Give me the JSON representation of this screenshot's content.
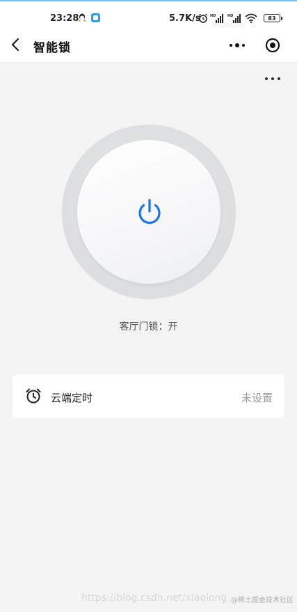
{
  "status_bar": {
    "time": "23:28",
    "network_speed": "5.7K/s",
    "battery": "83",
    "icons": [
      "qq-icon",
      "app-icon",
      "alarm-status-icon",
      "hd-signal-icon",
      "hd-signal-icon",
      "wifi-icon",
      "battery-icon"
    ]
  },
  "nav": {
    "title": "智能锁"
  },
  "device": {
    "status_text": "客厅门锁：开",
    "power_color": "#1a73e8"
  },
  "timer": {
    "label": "云端定时",
    "value": "未设置"
  },
  "watermark": {
    "text": "https://blog.csdn.net/xiaolong",
    "badge": "@稀土掘金技术社区"
  }
}
